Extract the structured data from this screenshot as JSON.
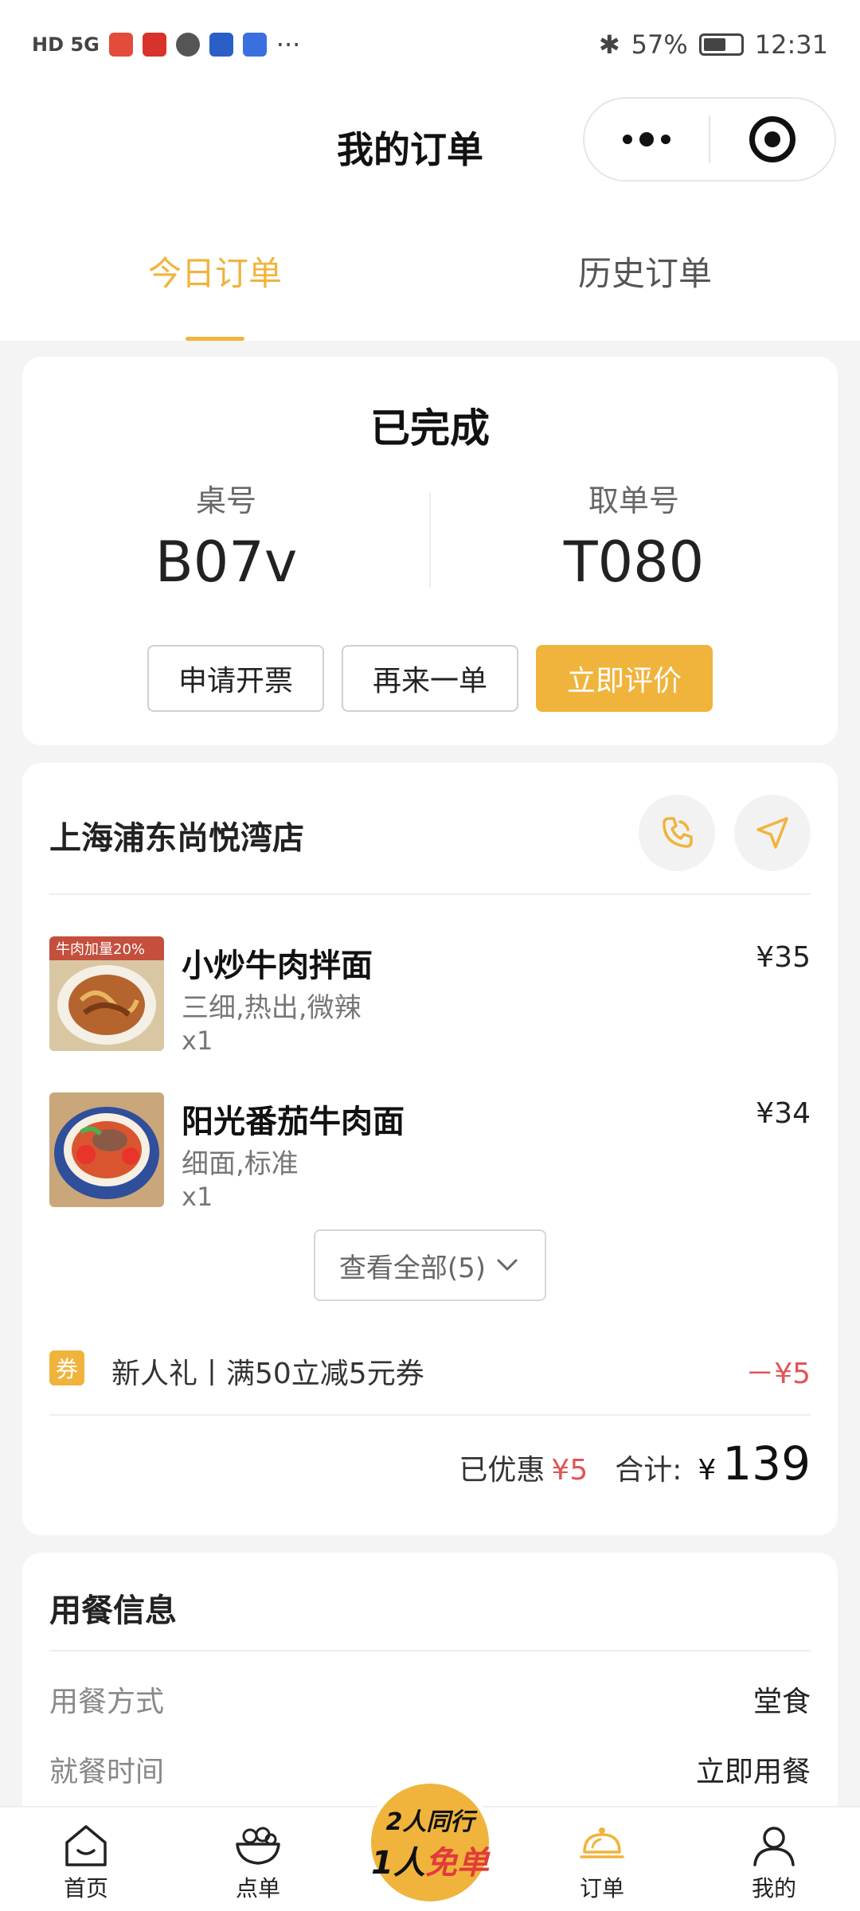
{
  "status_bar": {
    "left_text": "HD 5G",
    "battery": "57%",
    "time": "12:31",
    "more": "···"
  },
  "header": {
    "title": "我的订单"
  },
  "tabs": [
    {
      "label": "今日订单",
      "active": true
    },
    {
      "label": "历史订单",
      "active": false
    }
  ],
  "order_status": {
    "status": "已完成",
    "table_label": "桌号",
    "table_value": "B07v",
    "pickup_label": "取单号",
    "pickup_value": "T080",
    "buttons": [
      "申请开票",
      "再来一单",
      "立即评价"
    ]
  },
  "store": {
    "name": "上海浦东尚悦湾店",
    "items": [
      {
        "name": "小炒牛肉拌面",
        "spec": "三细,热出,微辣",
        "qty": "x1",
        "price": "¥35",
        "image_badge": "牛肉加量20%"
      },
      {
        "name": "阳光番茄牛肉面",
        "spec": "细面,标准",
        "qty": "x1",
        "price": "¥34"
      }
    ],
    "view_all": "查看全部(5)",
    "coupon_badge": "券",
    "coupon_text": "新人礼丨满50立减5元券",
    "coupon_amount": "－¥5",
    "discount_label": "已优惠",
    "discount_value": "¥5",
    "total_label": "合计:",
    "total_currency": "¥",
    "total_value": "139"
  },
  "dining_info": {
    "title": "用餐信息",
    "rows": [
      {
        "key": "用餐方式",
        "value": "堂食"
      },
      {
        "key": "就餐时间",
        "value": "立即用餐"
      }
    ]
  },
  "tabbar": {
    "items": [
      "首页",
      "点单",
      "订单",
      "我的"
    ],
    "promo_line1": "2人同行",
    "promo_line2a": "1人",
    "promo_line2b": "免单"
  },
  "colors": {
    "accent": "#f0b43c",
    "price_red": "#e25555"
  }
}
